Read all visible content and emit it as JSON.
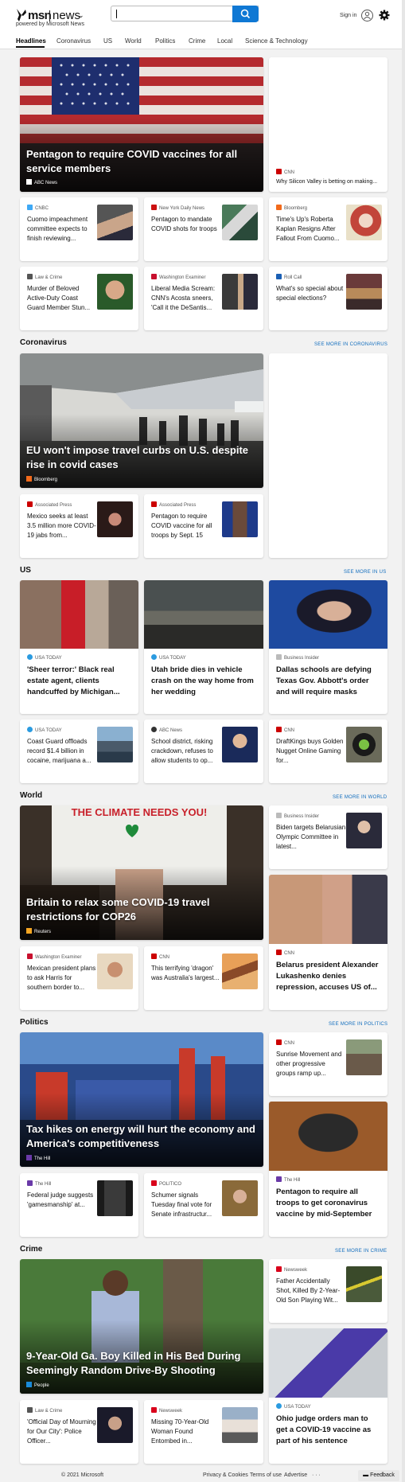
{
  "header": {
    "brand": "msn",
    "section": "news",
    "powered": "powered by Microsoft News",
    "search_placeholder": "",
    "signin": "Sign in"
  },
  "nav": [
    "Headlines",
    "Coronavirus",
    "US",
    "World",
    "Politics",
    "Crime",
    "Local",
    "Science & Technology"
  ],
  "top": {
    "hero": {
      "title": "Pentagon to require COVID vaccines for all service members",
      "source": "ABC News"
    },
    "side": {
      "source": "CNN",
      "title": "Why Silicon Valley is betting on making..."
    },
    "row1": [
      {
        "source": "CNBC",
        "title": "Cuomo impeachment committee expects to finish reviewing..."
      },
      {
        "source": "New York Daily News",
        "title": "Pentagon to mandate COVID shots for troops"
      },
      {
        "source": "Bloomberg",
        "title": "Time's Up's Roberta Kaplan Resigns After Fallout From Cuomo..."
      }
    ],
    "row2": [
      {
        "source": "Law & Crime",
        "title": "Murder of Beloved Active-Duty Coast Guard Member Stun..."
      },
      {
        "source": "Washington Examiner",
        "title": "Liberal Media Scream: CNN's Acosta sneers, 'Call it the DeSantis..."
      },
      {
        "source": "Roll Call",
        "title": "What's so special about special elections?"
      }
    ]
  },
  "coronavirus": {
    "heading": "Coronavirus",
    "more": "SEE MORE IN CORONAVIRUS",
    "hero": {
      "title": "EU won't impose travel curbs on U.S. despite rise in covid cases",
      "source": "Bloomberg"
    },
    "row": [
      {
        "source": "Associated Press",
        "title": "Mexico seeks at least 3.5 million more COVID-19 jabs from..."
      },
      {
        "source": "Associated Press",
        "title": "Pentagon to require COVID vaccine for all troops by Sept. 15"
      }
    ]
  },
  "us": {
    "heading": "US",
    "more": "SEE MORE IN US",
    "mids": [
      {
        "source": "USA TODAY",
        "title": "'Sheer terror:' Black real estate agent, clients handcuffed by Michigan..."
      },
      {
        "source": "USA TODAY",
        "title": "Utah bride dies in vehicle crash on the way home from her wedding"
      },
      {
        "source": "Business Insider",
        "title": "Dallas schools are defying Texas Gov. Abbott's order and will require masks"
      }
    ],
    "row": [
      {
        "source": "USA TODAY",
        "title": "Coast Guard offloads record $1.4 billion in cocaine, marijuana a..."
      },
      {
        "source": "ABC News",
        "title": "School district, risking crackdown, refuses to allow students to op..."
      },
      {
        "source": "CNN",
        "title": "DraftKings buys Golden Nugget Online Gaming for..."
      }
    ]
  },
  "world": {
    "heading": "World",
    "more": "SEE MORE IN WORLD",
    "hero": {
      "title": "Britain to relax some COVID-19 travel restrictions for COP26",
      "source": "Reuters",
      "sign": "THE CLIMATE NEEDS YOU!"
    },
    "side": {
      "source": "Business Insider",
      "title": "Biden targets Belarusian Olympic Committee in latest..."
    },
    "side2": {
      "source": "CNN",
      "title": "Belarus president Alexander Lukashenko denies repression, accuses US of..."
    },
    "row": [
      {
        "source": "Washington Examiner",
        "title": "Mexican president plans to ask Harris for southern border to..."
      },
      {
        "source": "CNN",
        "title": "This terrifying 'dragon' was Australia's largest..."
      }
    ]
  },
  "politics": {
    "heading": "Politics",
    "more": "SEE MORE IN POLITICS",
    "hero": {
      "title": "Tax hikes on energy will hurt the economy and America's competitiveness",
      "source": "The Hill"
    },
    "side": {
      "source": "CNN",
      "title": "Sunrise Movement and other progressive groups ramp up..."
    },
    "side2": {
      "source": "The Hill",
      "title": "Pentagon to require all troops to get coronavirus vaccine by mid-September"
    },
    "row": [
      {
        "source": "The Hill",
        "title": "Federal judge suggests 'gamesmanship' at..."
      },
      {
        "source": "POLITICO",
        "title": "Schumer signals Tuesday final vote for Senate infrastructur..."
      }
    ]
  },
  "crime": {
    "heading": "Crime",
    "more": "SEE MORE IN CRIME",
    "hero": {
      "title": "9-Year-Old Ga. Boy Killed in His Bed During Seemingly Random Drive-By Shooting",
      "source": "People"
    },
    "side": {
      "source": "Newsweek",
      "title": "Father Accidentally Shot, Killed By 2-Year-Old Son Playing Wit..."
    },
    "side2": {
      "source": "USA TODAY",
      "title": "Ohio judge orders man to get a COVID-19 vaccine as part of his sentence"
    },
    "row": [
      {
        "source": "Law & Crime",
        "title": "'Official Day of Mourning for Our City': Police Officer..."
      },
      {
        "source": "Newsweek",
        "title": "Missing 70-Year-Old Woman Found Entombed in..."
      }
    ]
  },
  "footer": {
    "copyright": "© 2021 Microsoft",
    "privacy": "Privacy & Cookies",
    "terms": "Terms of use",
    "advertise": "Advertise",
    "more": "· · ·",
    "feedback": "Feedback"
  }
}
